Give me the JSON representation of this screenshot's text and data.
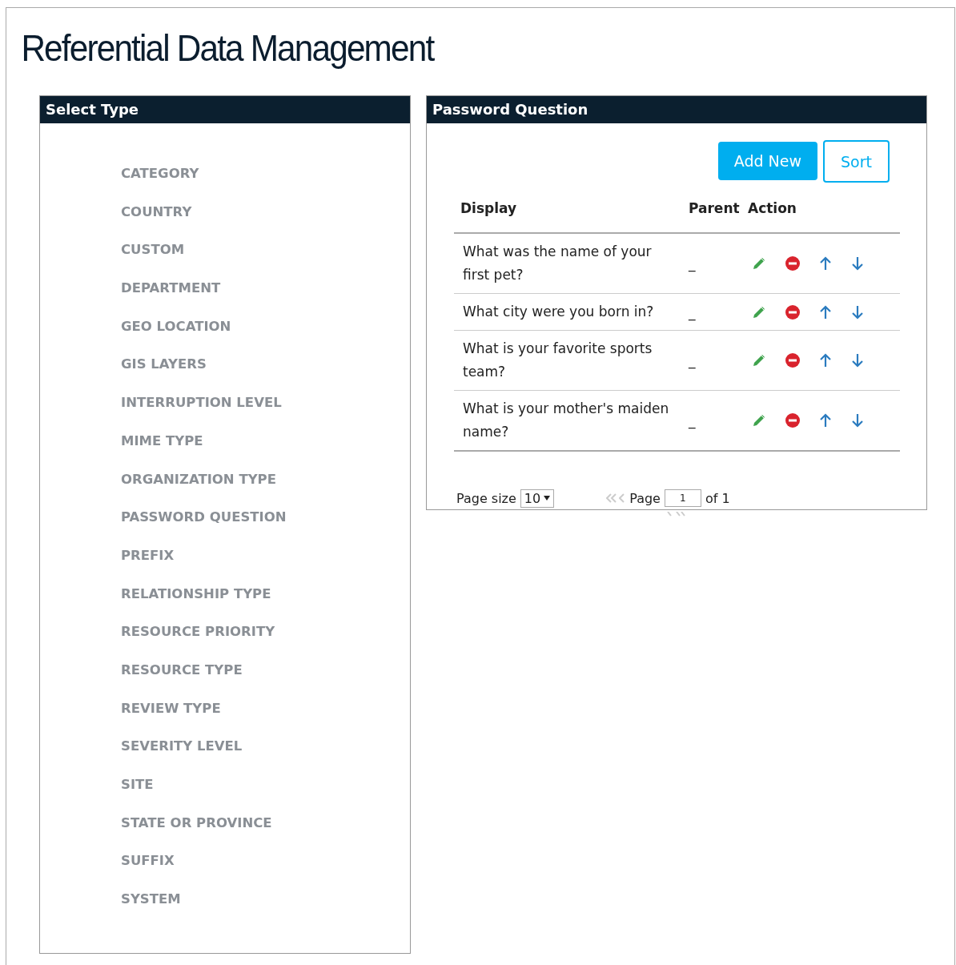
{
  "page_title": "Referential Data Management",
  "type_panel": {
    "title": "Select Type",
    "items": [
      "CATEGORY",
      "COUNTRY",
      "CUSTOM",
      "DEPARTMENT",
      "GEO LOCATION",
      "GIS LAYERS",
      "INTERRUPTION LEVEL",
      "MIME TYPE",
      "ORGANIZATION TYPE",
      "PASSWORD QUESTION",
      "PREFIX",
      "RELATIONSHIP TYPE",
      "RESOURCE PRIORITY",
      "RESOURCE TYPE",
      "REVIEW TYPE",
      "SEVERITY LEVEL",
      "SITE",
      "STATE OR PROVINCE",
      "SUFFIX",
      "SYSTEM"
    ]
  },
  "detail_panel": {
    "title": "Password Question",
    "buttons": [
      {
        "label": "Add New",
        "kind": "primary"
      },
      {
        "label": "Sort",
        "kind": "outline"
      }
    ],
    "table": {
      "columns": [
        "Display",
        "Parent",
        "Action"
      ],
      "rows": [
        {
          "display": "What was the name of your first pet?",
          "parent": "_"
        },
        {
          "display": "What city were you born in?",
          "parent": "_"
        },
        {
          "display": "What is your favorite sports team?",
          "parent": "_"
        },
        {
          "display": "What is your mother's maiden name?",
          "parent": "_"
        }
      ]
    },
    "pager": {
      "page_size_label": "Page size",
      "page_size": "10",
      "page_label": "Page",
      "page": "1",
      "of_label": "of 1"
    }
  }
}
